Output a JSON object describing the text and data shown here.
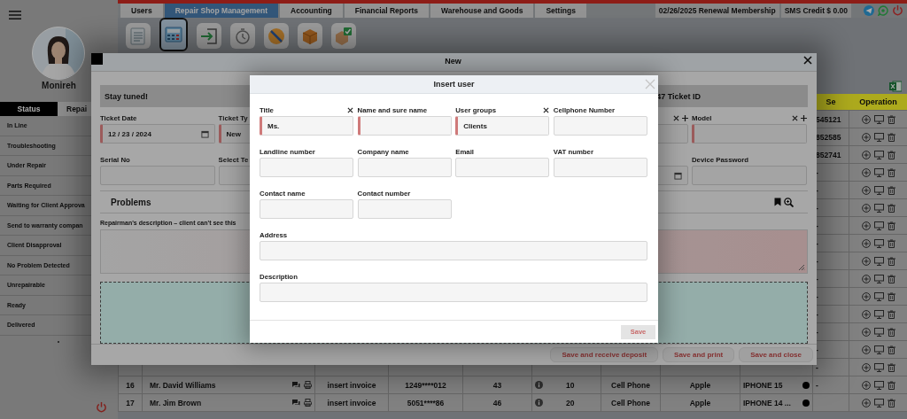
{
  "sidebar": {
    "user_name": "Monireh",
    "tabs": [
      {
        "label": "Status",
        "selected": true
      },
      {
        "label": "Repai",
        "selected": false
      }
    ],
    "items": [
      "In Line",
      "Troubleshooting",
      "Under Repair",
      "Parts Required",
      "Waiting for Client Approva",
      "Send to warranty compan",
      "Client Disapproval",
      "No Problem Detected",
      "Unrepairable",
      "Ready",
      "Delivered"
    ]
  },
  "menu_tabs": [
    {
      "label": "Users",
      "selected": false
    },
    {
      "label": "Repair Shop Management",
      "selected": true
    },
    {
      "label": "Accounting",
      "selected": false
    },
    {
      "label": "Financial Reports",
      "selected": false
    },
    {
      "label": "Warehouse and Goods",
      "selected": false
    },
    {
      "label": "Settings",
      "selected": false
    }
  ],
  "membership": "02/26/2025 Renewal Membership",
  "sms_credit": "SMS Credit $ 0.00",
  "toolbar": [
    {
      "kind": "staff",
      "selected": false
    },
    {
      "kind": "ticket",
      "selected": true
    },
    {
      "kind": "report",
      "selected": false
    },
    {
      "kind": "in_line",
      "selected": false
    },
    {
      "kind": "under_repair",
      "selected": false
    },
    {
      "kind": "ready",
      "selected": false
    },
    {
      "kind": "delivered",
      "selected": false
    }
  ],
  "table": {
    "columns": [
      "Se",
      "Operation"
    ],
    "rows": [
      {
        "se": "545121"
      },
      {
        "se": "852585"
      },
      {
        "se": "852741"
      },
      {
        "se": "-"
      },
      {
        "se": "-"
      },
      {
        "se": "-"
      },
      {
        "se": "-"
      },
      {
        "se": "-"
      },
      {
        "se": "-"
      },
      {
        "se": "-"
      },
      {
        "se": "-"
      },
      {
        "se": "-"
      },
      {
        "se": "-"
      },
      {
        "se": "-"
      },
      {
        "se": "-"
      },
      {
        "column_1": "16",
        "column_2": "Mr. David Williams",
        "column_3": "insert invoice",
        "column_4": "1249****012",
        "column_5": "43",
        "column_6": "10",
        "column_7": "Cell Phone",
        "column_8": "Apple",
        "column_9": "IPHONE 15",
        "se": "-"
      },
      {
        "column_1": "17",
        "column_2": "Mr. Jim Brown",
        "column_3": "insert invoice",
        "column_4": "5051****86",
        "column_5": "46",
        "column_6": "20",
        "column_7": "Cell Phone",
        "column_8": "Apple",
        "column_9": "IPHONE 14 ..."
      }
    ]
  },
  "new_dialog": {
    "title": "New",
    "notice": "Stay tuned!",
    "ticket_id": "47 Ticket ID",
    "fields": [
      {
        "label": "Ticket Date",
        "value": "12 / 23 / 2024",
        "kind": "date",
        "required": true
      },
      {
        "label": "Ticket Ty",
        "value": "New",
        "kind": "select",
        "required": true
      },
      {
        "kind": "select",
        "clearable": true,
        "addable": true
      },
      {
        "label": "Model",
        "kind": "select",
        "required": true,
        "clearable": true,
        "addable": true
      },
      {
        "label": "Serial No",
        "kind": "text",
        "required": false
      },
      {
        "label": "Select Te",
        "kind": "select",
        "required": false
      },
      {
        "kind": "date"
      },
      {
        "label": "Device Password",
        "kind": "text",
        "required": false
      }
    ],
    "section": "Problems",
    "description_label": "Repairman's description – client can't see this",
    "buttons": [
      {
        "label": "Save and receive deposit",
        "disabled": true
      },
      {
        "label": "Save and print",
        "disabled": true
      },
      {
        "label": "Save and close",
        "disabled": true
      }
    ]
  },
  "insert_user": {
    "title": "Insert user",
    "fields": [
      {
        "label": "Title",
        "value": "Ms.",
        "kind": "text",
        "required": true,
        "clearable": true
      },
      {
        "label": "Name and sure name",
        "kind": "text",
        "required": true
      },
      {
        "label": "User groups",
        "value": "Clients",
        "kind": "text",
        "required": true,
        "clearable": true
      },
      {
        "label": "Cellphone Number",
        "kind": "text",
        "required": false
      },
      {
        "label": "Landline number",
        "kind": "text",
        "required": false
      },
      {
        "label": "Company name",
        "kind": "text",
        "required": false
      },
      {
        "label": "Email",
        "kind": "text",
        "required": false
      },
      {
        "label": "VAT number",
        "kind": "text",
        "required": false
      },
      {
        "label": "Contact name",
        "kind": "text",
        "required": false
      },
      {
        "label": "Contact number",
        "kind": "text",
        "required": false
      },
      {
        "label": "Address",
        "kind": "wide",
        "required": false
      },
      {
        "label": "Description",
        "kind": "wide",
        "required": false
      }
    ],
    "save": {
      "label": "Save",
      "disabled": true
    }
  }
}
